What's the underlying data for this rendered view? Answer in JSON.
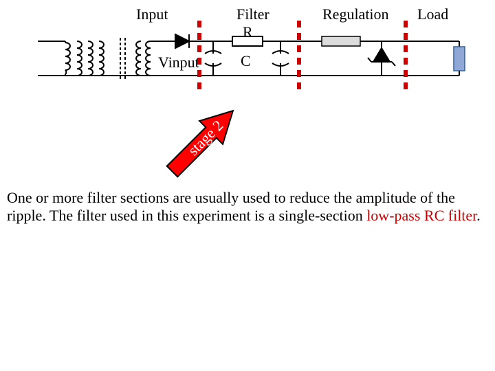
{
  "sections": {
    "input": "Input",
    "filter": "Filter",
    "regulation": "Regulation",
    "load": "Load"
  },
  "components": {
    "vinput": "Vinput",
    "r": "R",
    "c": "C"
  },
  "pointer": "stage 2",
  "paragraph": {
    "part1": "One or more filter sections are usually used to reduce the amplitude of the ripple. The filter used in this experiment is a single-section ",
    "lowpass": "low-pass RC filter",
    "part2": "."
  },
  "colors": {
    "wire": "#000000",
    "divider": "#cc0000",
    "arrow_fill": "#ff0000",
    "arrow_stroke": "#000000",
    "zener": "#000000",
    "load_fill": "#8fa8d6",
    "load_stroke": "#30609a",
    "reg_fill": "#dcdcdc"
  }
}
